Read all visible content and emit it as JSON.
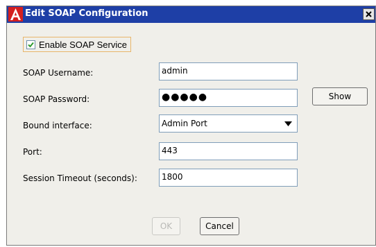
{
  "window": {
    "title": "Edit SOAP Configuration",
    "app_icon": "adobe-a-icon",
    "close_icon": "close-x-icon"
  },
  "enable_soap": {
    "label": "Enable SOAP Service",
    "checked": true
  },
  "fields": {
    "username": {
      "label": "SOAP Username:",
      "value": "admin"
    },
    "password": {
      "label": "SOAP Password:",
      "value": "●●●●●",
      "show_label": "Show"
    },
    "bound_interface": {
      "label": "Bound interface:",
      "value": "Admin Port"
    },
    "port": {
      "label": "Port:",
      "value": "443"
    },
    "session_timeout": {
      "label": "Session Timeout (seconds):",
      "value": "1800"
    }
  },
  "buttons": {
    "ok": "OK",
    "cancel": "Cancel"
  },
  "colors": {
    "titlebar": "#1e3fa6",
    "app_icon": "#d41f1f",
    "dialog_bg": "#f0efea",
    "focus_border": "#e8b56a"
  }
}
